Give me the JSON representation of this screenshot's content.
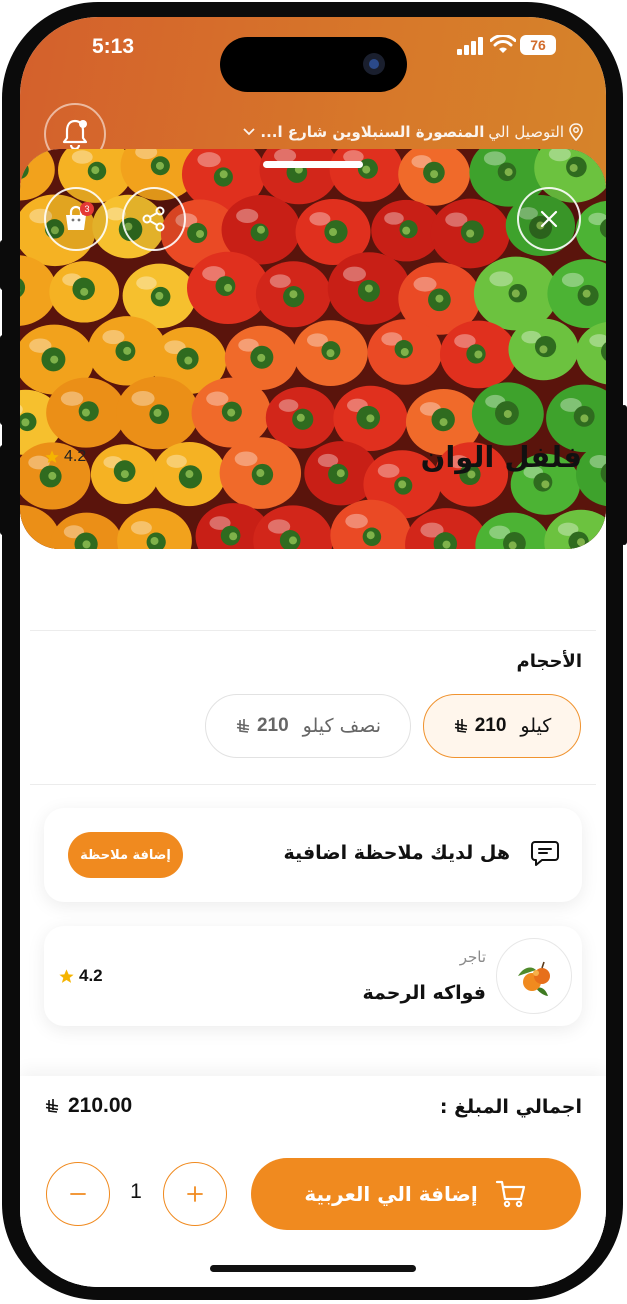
{
  "status_bar": {
    "time": "5:13",
    "battery": "76"
  },
  "header": {
    "delivery_prefix": "التوصيل الي",
    "delivery_address": "المنصورة السنبلاوين شارع ا...",
    "cart_count": "3"
  },
  "product": {
    "title": "فلفل الوان",
    "rating": "4.2"
  },
  "sizes": {
    "label": "الأحجام",
    "options": [
      {
        "name": "كيلو",
        "price": "210",
        "selected": true
      },
      {
        "name": "نصف كيلو",
        "price": "210",
        "selected": false
      }
    ]
  },
  "note": {
    "question": "هل لديك ملاحظة اضافية",
    "button": "إضافة ملاحظة"
  },
  "vendor": {
    "tag": "تاجر",
    "name": "فواكه الرحمة",
    "rating": "4.2"
  },
  "footer": {
    "total_label": "اجمالي المبلغ :",
    "total_value": "210.00",
    "quantity": "1",
    "add_to_cart": "إضافة الي العربية"
  },
  "colors": {
    "accent": "#f08a1f",
    "header_bg": "#d6702b",
    "star": "#f5b400"
  }
}
